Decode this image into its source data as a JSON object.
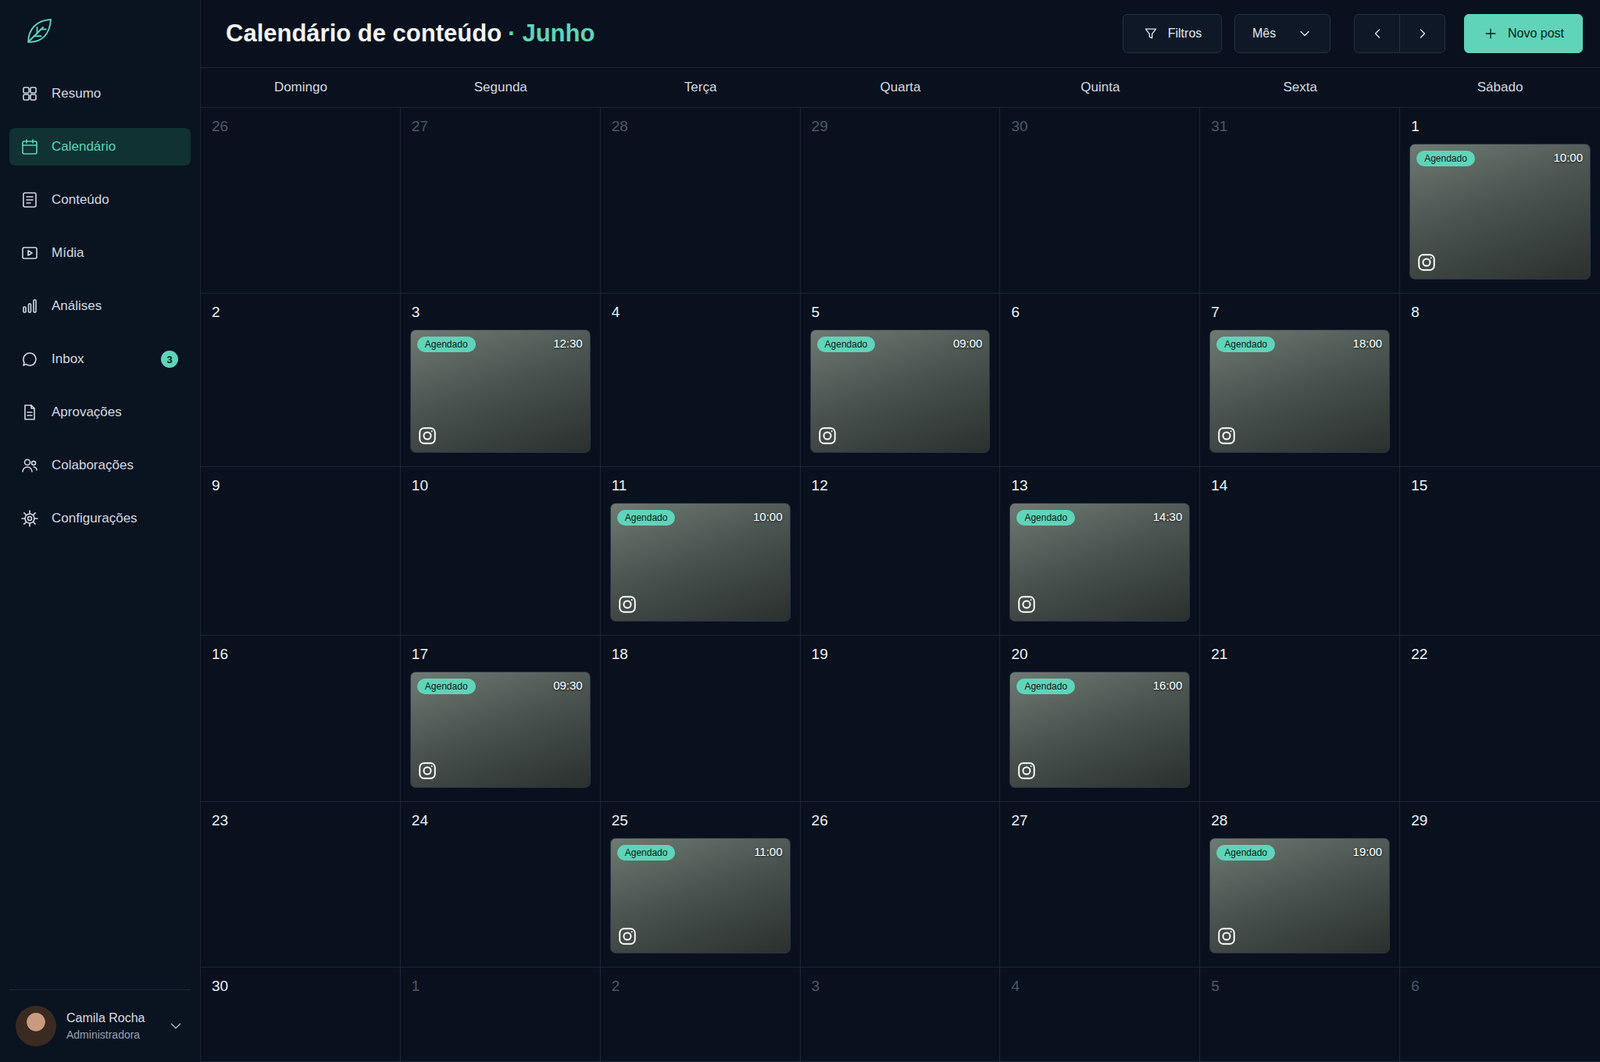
{
  "sidebar": {
    "items": [
      {
        "label": "Resumo",
        "selected": false
      },
      {
        "label": "Calendário",
        "selected": true
      },
      {
        "label": "Conteúdo",
        "selected": false
      },
      {
        "label": "Mídia",
        "selected": false
      },
      {
        "label": "Análises",
        "selected": false
      },
      {
        "label": "Inbox",
        "selected": false,
        "badge": "3"
      },
      {
        "label": "Aprovações",
        "selected": false
      },
      {
        "label": "Colaborações",
        "selected": false
      },
      {
        "label": "Configurações",
        "selected": false
      }
    ]
  },
  "user": {
    "name": "Camila Rocha",
    "role": "Administradora"
  },
  "header": {
    "title": "Calendário de conteúdo",
    "separator": "·",
    "month": "Junho"
  },
  "toolbar": {
    "filter": "Filtros",
    "view": "Mês",
    "new_post": "Novo post"
  },
  "weekdays": [
    "Domingo",
    "Segunda",
    "Terça",
    "Quarta",
    "Quinta",
    "Sexta",
    "Sábado"
  ],
  "weeks": [
    [
      {
        "day": "26",
        "in_month": false,
        "posts": []
      },
      {
        "day": "27",
        "in_month": false,
        "posts": []
      },
      {
        "day": "28",
        "in_month": false,
        "posts": []
      },
      {
        "day": "29",
        "in_month": false,
        "posts": []
      },
      {
        "day": "30",
        "in_month": false,
        "posts": []
      },
      {
        "day": "31",
        "in_month": false,
        "posts": []
      },
      {
        "day": "1",
        "in_month": true,
        "posts": [
          {
            "status": "Agendado",
            "time": "10:00"
          }
        ]
      }
    ],
    [
      {
        "day": "2",
        "in_month": true,
        "posts": []
      },
      {
        "day": "3",
        "in_month": true,
        "posts": [
          {
            "status": "Agendado",
            "time": "12:30"
          }
        ]
      },
      {
        "day": "4",
        "in_month": true,
        "posts": []
      },
      {
        "day": "5",
        "in_month": true,
        "posts": [
          {
            "status": "Agendado",
            "time": "09:00"
          }
        ]
      },
      {
        "day": "6",
        "in_month": true,
        "posts": []
      },
      {
        "day": "7",
        "in_month": true,
        "posts": [
          {
            "status": "Agendado",
            "time": "18:00"
          }
        ]
      },
      {
        "day": "8",
        "in_month": true,
        "posts": []
      }
    ],
    [
      {
        "day": "9",
        "in_month": true,
        "posts": []
      },
      {
        "day": "10",
        "in_month": true,
        "posts": []
      },
      {
        "day": "11",
        "in_month": true,
        "posts": [
          {
            "status": "Agendado",
            "time": "10:00"
          }
        ]
      },
      {
        "day": "12",
        "in_month": true,
        "posts": []
      },
      {
        "day": "13",
        "in_month": true,
        "posts": [
          {
            "status": "Agendado",
            "time": "14:30"
          }
        ]
      },
      {
        "day": "14",
        "in_month": true,
        "posts": []
      },
      {
        "day": "15",
        "in_month": true,
        "posts": []
      }
    ],
    [
      {
        "day": "16",
        "in_month": true,
        "posts": []
      },
      {
        "day": "17",
        "in_month": true,
        "posts": [
          {
            "status": "Agendado",
            "time": "09:30"
          }
        ]
      },
      {
        "day": "18",
        "in_month": true,
        "posts": []
      },
      {
        "day": "19",
        "in_month": true,
        "posts": []
      },
      {
        "day": "20",
        "in_month": true,
        "posts": [
          {
            "status": "Agendado",
            "time": "16:00"
          }
        ]
      },
      {
        "day": "21",
        "in_month": true,
        "posts": []
      },
      {
        "day": "22",
        "in_month": true,
        "posts": []
      }
    ],
    [
      {
        "day": "23",
        "in_month": true,
        "posts": []
      },
      {
        "day": "24",
        "in_month": true,
        "posts": []
      },
      {
        "day": "25",
        "in_month": true,
        "posts": [
          {
            "status": "Agendado",
            "time": "11:00"
          }
        ]
      },
      {
        "day": "26",
        "in_month": true,
        "posts": []
      },
      {
        "day": "27",
        "in_month": true,
        "posts": []
      },
      {
        "day": "28",
        "in_month": true,
        "posts": [
          {
            "status": "Agendado",
            "time": "19:00"
          }
        ]
      },
      {
        "day": "29",
        "in_month": true,
        "posts": []
      }
    ],
    [
      {
        "day": "30",
        "in_month": true,
        "posts": []
      },
      {
        "day": "1",
        "in_month": false,
        "posts": []
      },
      {
        "day": "2",
        "in_month": false,
        "posts": []
      },
      {
        "day": "3",
        "in_month": false,
        "posts": []
      },
      {
        "day": "4",
        "in_month": false,
        "posts": []
      },
      {
        "day": "5",
        "in_month": false,
        "posts": []
      },
      {
        "day": "6",
        "in_month": false,
        "posts": []
      }
    ]
  ]
}
